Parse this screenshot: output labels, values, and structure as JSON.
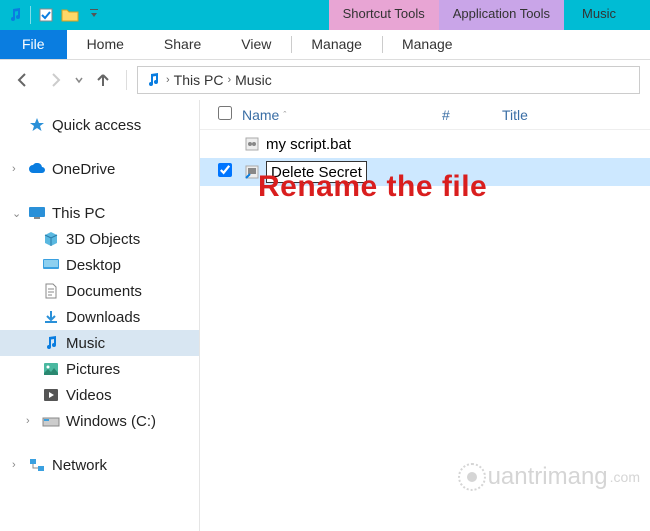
{
  "titlebar": {
    "tabs": {
      "shortcut": "Shortcut Tools",
      "application": "Application Tools",
      "title": "Music"
    }
  },
  "ribbon": {
    "file": "File",
    "home": "Home",
    "share": "Share",
    "view": "View",
    "manage1": "Manage",
    "manage2": "Manage"
  },
  "breadcrumb": {
    "seg1": "This PC",
    "seg2": "Music"
  },
  "columns": {
    "name": "Name",
    "num": "#",
    "title": "Title"
  },
  "files": [
    {
      "name": "my script.bat",
      "selected": false,
      "renaming": false
    },
    {
      "name": "Delete Secret",
      "selected": true,
      "renaming": true
    }
  ],
  "nav": {
    "quick_access": "Quick access",
    "onedrive": "OneDrive",
    "this_pc": "This PC",
    "objects3d": "3D Objects",
    "desktop": "Desktop",
    "documents": "Documents",
    "downloads": "Downloads",
    "music": "Music",
    "pictures": "Pictures",
    "videos": "Videos",
    "drive_c": "Windows (C:)",
    "network": "Network"
  },
  "annotation": "Rename the file",
  "watermark": "uantrimang"
}
